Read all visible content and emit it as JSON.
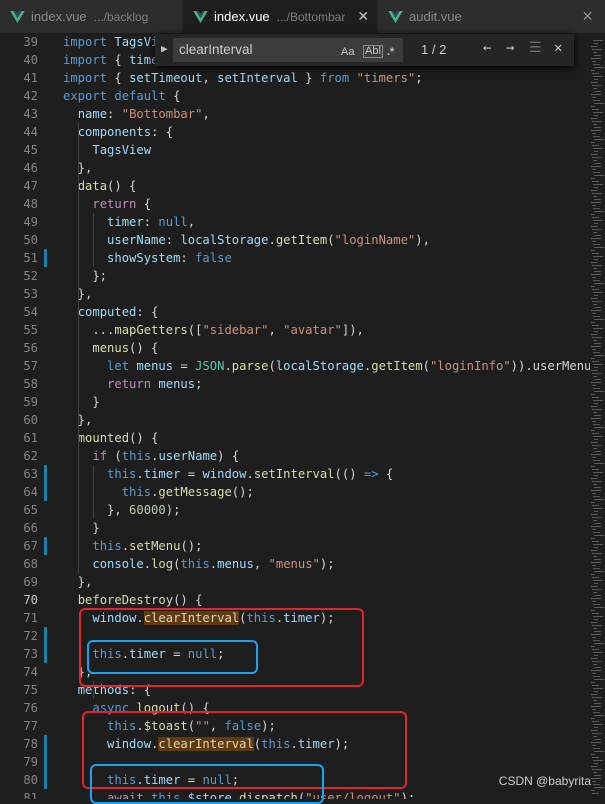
{
  "tabs": [
    {
      "name": "index.vue",
      "path": ".../backlog",
      "active": false
    },
    {
      "name": "index.vue",
      "path": ".../Bottombar",
      "active": true
    },
    {
      "name": "audit.vue",
      "path": "",
      "active": false
    }
  ],
  "find_widget": {
    "query": "clearInterval",
    "match_case": "Aa",
    "whole_word": "Abl",
    "regex": ".*",
    "result_count": "1 / 2"
  },
  "current_line": 70,
  "code_lines": [
    {
      "n": 39,
      "tokens": [
        [
          "kw",
          "import "
        ],
        [
          "var",
          "TagsVi"
        ]
      ]
    },
    {
      "n": 40,
      "tokens": [
        [
          "kw",
          "import "
        ],
        [
          "plain",
          "{ "
        ],
        [
          "var",
          "time"
        ]
      ]
    },
    {
      "n": 41,
      "tokens": [
        [
          "kw",
          "import "
        ],
        [
          "plain",
          "{ "
        ],
        [
          "var",
          "setTimeout"
        ],
        [
          "plain",
          ", "
        ],
        [
          "var",
          "setInterval"
        ],
        [
          "plain",
          " } "
        ],
        [
          "kw",
          "from "
        ],
        [
          "str",
          "\"timers\""
        ],
        [
          "plain",
          ";"
        ]
      ]
    },
    {
      "n": 42,
      "tokens": [
        [
          "kw",
          "export default "
        ],
        [
          "plain",
          "{"
        ]
      ]
    },
    {
      "n": 43,
      "tokens": [
        [
          "plain",
          "  "
        ],
        [
          "var",
          "name"
        ],
        [
          "plain",
          ": "
        ],
        [
          "str",
          "\"Bottombar\""
        ],
        [
          "plain",
          ","
        ]
      ]
    },
    {
      "n": 44,
      "tokens": [
        [
          "plain",
          "  "
        ],
        [
          "var",
          "components"
        ],
        [
          "plain",
          ": {"
        ]
      ]
    },
    {
      "n": 45,
      "tokens": [
        [
          "plain",
          "    "
        ],
        [
          "var",
          "TagsView"
        ]
      ]
    },
    {
      "n": 46,
      "tokens": [
        [
          "plain",
          "  },"
        ]
      ]
    },
    {
      "n": 47,
      "tokens": [
        [
          "plain",
          "  "
        ],
        [
          "fn",
          "data"
        ],
        [
          "plain",
          "() {"
        ]
      ]
    },
    {
      "n": 48,
      "tokens": [
        [
          "plain",
          "    "
        ],
        [
          "ctl",
          "return"
        ],
        [
          "plain",
          " {"
        ]
      ]
    },
    {
      "n": 49,
      "tokens": [
        [
          "plain",
          "      "
        ],
        [
          "var",
          "timer"
        ],
        [
          "plain",
          ": "
        ],
        [
          "kw",
          "null"
        ],
        [
          "plain",
          ","
        ]
      ]
    },
    {
      "n": 50,
      "tokens": [
        [
          "plain",
          "      "
        ],
        [
          "var",
          "userName"
        ],
        [
          "plain",
          ": "
        ],
        [
          "var",
          "localStorage"
        ],
        [
          "plain",
          "."
        ],
        [
          "fn",
          "getItem"
        ],
        [
          "plain",
          "("
        ],
        [
          "str",
          "\"loginName\""
        ],
        [
          "plain",
          "),"
        ]
      ]
    },
    {
      "n": 51,
      "tokens": [
        [
          "plain",
          "      "
        ],
        [
          "var",
          "showSystem"
        ],
        [
          "plain",
          ": "
        ],
        [
          "kw",
          "false"
        ]
      ],
      "mod": true
    },
    {
      "n": 52,
      "tokens": [
        [
          "plain",
          "    };"
        ]
      ]
    },
    {
      "n": 53,
      "tokens": [
        [
          "plain",
          "  },"
        ]
      ]
    },
    {
      "n": 54,
      "tokens": [
        [
          "plain",
          "  "
        ],
        [
          "var",
          "computed"
        ],
        [
          "plain",
          ": {"
        ]
      ]
    },
    {
      "n": 55,
      "tokens": [
        [
          "plain",
          "    ..."
        ],
        [
          "fn",
          "mapGetters"
        ],
        [
          "plain",
          "(["
        ],
        [
          "str",
          "\"sidebar\""
        ],
        [
          "plain",
          ", "
        ],
        [
          "str",
          "\"avatar\""
        ],
        [
          "plain",
          "]),"
        ]
      ]
    },
    {
      "n": 56,
      "tokens": [
        [
          "plain",
          "    "
        ],
        [
          "fn",
          "menus"
        ],
        [
          "plain",
          "() {"
        ]
      ]
    },
    {
      "n": 57,
      "tokens": [
        [
          "plain",
          "      "
        ],
        [
          "kw",
          "let "
        ],
        [
          "var",
          "menus"
        ],
        [
          "plain",
          " = "
        ],
        [
          "cls",
          "JSON"
        ],
        [
          "plain",
          "."
        ],
        [
          "fn",
          "parse"
        ],
        [
          "plain",
          "("
        ],
        [
          "var",
          "localStorage"
        ],
        [
          "plain",
          "."
        ],
        [
          "fn",
          "getItem"
        ],
        [
          "plain",
          "("
        ],
        [
          "str",
          "\"loginInfo\""
        ],
        [
          "plain",
          ")).userMenu"
        ]
      ]
    },
    {
      "n": 58,
      "tokens": [
        [
          "plain",
          "      "
        ],
        [
          "ctl",
          "return "
        ],
        [
          "var",
          "menus"
        ],
        [
          "plain",
          ";"
        ]
      ]
    },
    {
      "n": 59,
      "tokens": [
        [
          "plain",
          "    }"
        ]
      ]
    },
    {
      "n": 60,
      "tokens": [
        [
          "plain",
          "  },"
        ]
      ]
    },
    {
      "n": 61,
      "tokens": [
        [
          "plain",
          "  "
        ],
        [
          "fn",
          "mounted"
        ],
        [
          "plain",
          "() {"
        ]
      ]
    },
    {
      "n": 62,
      "tokens": [
        [
          "plain",
          "    "
        ],
        [
          "ctl",
          "if"
        ],
        [
          "plain",
          " ("
        ],
        [
          "kw",
          "this"
        ],
        [
          "plain",
          "."
        ],
        [
          "var",
          "userName"
        ],
        [
          "plain",
          ") {"
        ]
      ]
    },
    {
      "n": 63,
      "tokens": [
        [
          "plain",
          "      "
        ],
        [
          "kw",
          "this"
        ],
        [
          "plain",
          "."
        ],
        [
          "var",
          "timer"
        ],
        [
          "plain",
          " = "
        ],
        [
          "var",
          "window"
        ],
        [
          "plain",
          "."
        ],
        [
          "fn",
          "setInterval"
        ],
        [
          "plain",
          "(() "
        ],
        [
          "kw",
          "=>"
        ],
        [
          "plain",
          " {"
        ]
      ],
      "mod": true
    },
    {
      "n": 64,
      "tokens": [
        [
          "plain",
          "        "
        ],
        [
          "kw",
          "this"
        ],
        [
          "plain",
          "."
        ],
        [
          "fn",
          "getMessage"
        ],
        [
          "plain",
          "();"
        ]
      ],
      "mod": true
    },
    {
      "n": 65,
      "tokens": [
        [
          "plain",
          "      }, "
        ],
        [
          "num",
          "60000"
        ],
        [
          "plain",
          ");"
        ]
      ]
    },
    {
      "n": 66,
      "tokens": [
        [
          "plain",
          "    }"
        ]
      ]
    },
    {
      "n": 67,
      "tokens": [
        [
          "plain",
          "    "
        ],
        [
          "kw",
          "this"
        ],
        [
          "plain",
          "."
        ],
        [
          "fn",
          "setMenu"
        ],
        [
          "plain",
          "();"
        ]
      ],
      "mod": true
    },
    {
      "n": 68,
      "tokens": [
        [
          "plain",
          "    "
        ],
        [
          "var",
          "console"
        ],
        [
          "plain",
          "."
        ],
        [
          "fn",
          "log"
        ],
        [
          "plain",
          "("
        ],
        [
          "kw",
          "this"
        ],
        [
          "plain",
          "."
        ],
        [
          "var",
          "menus"
        ],
        [
          "plain",
          ", "
        ],
        [
          "str",
          "\"menus\""
        ],
        [
          "plain",
          ");"
        ]
      ]
    },
    {
      "n": 69,
      "tokens": [
        [
          "plain",
          "  },"
        ]
      ]
    },
    {
      "n": 70,
      "tokens": [
        [
          "plain",
          "  "
        ],
        [
          "fn",
          "beforeDestroy"
        ],
        [
          "plain",
          "() {"
        ]
      ]
    },
    {
      "n": 71,
      "tokens": [
        [
          "plain",
          "    "
        ],
        [
          "var",
          "window"
        ],
        [
          "plain",
          "."
        ],
        [
          "hl",
          "clearInterval"
        ],
        [
          "plain",
          "("
        ],
        [
          "kw",
          "this"
        ],
        [
          "plain",
          "."
        ],
        [
          "var",
          "timer"
        ],
        [
          "plain",
          ");"
        ]
      ]
    },
    {
      "n": 72,
      "tokens": [],
      "mod": true
    },
    {
      "n": 73,
      "tokens": [
        [
          "plain",
          "    "
        ],
        [
          "kw",
          "this"
        ],
        [
          "plain",
          "."
        ],
        [
          "var",
          "timer"
        ],
        [
          "plain",
          " = "
        ],
        [
          "kw",
          "null"
        ],
        [
          "plain",
          ";"
        ]
      ],
      "mod": true
    },
    {
      "n": 74,
      "tokens": [
        [
          "plain",
          "  },"
        ]
      ]
    },
    {
      "n": 75,
      "tokens": [
        [
          "plain",
          "  "
        ],
        [
          "var",
          "methods"
        ],
        [
          "plain",
          ": {"
        ]
      ]
    },
    {
      "n": 76,
      "tokens": [
        [
          "plain",
          "    "
        ],
        [
          "kw",
          "async "
        ],
        [
          "fn",
          "logout"
        ],
        [
          "plain",
          "() {"
        ]
      ]
    },
    {
      "n": 77,
      "tokens": [
        [
          "plain",
          "      "
        ],
        [
          "kw",
          "this"
        ],
        [
          "plain",
          "."
        ],
        [
          "fn",
          "$toast"
        ],
        [
          "plain",
          "("
        ],
        [
          "str",
          "\"\""
        ],
        [
          "plain",
          ", "
        ],
        [
          "kw",
          "false"
        ],
        [
          "plain",
          ");"
        ]
      ]
    },
    {
      "n": 78,
      "tokens": [
        [
          "plain",
          "      "
        ],
        [
          "var",
          "window"
        ],
        [
          "plain",
          "."
        ],
        [
          "hl",
          "clearInterval"
        ],
        [
          "plain",
          "("
        ],
        [
          "kw",
          "this"
        ],
        [
          "plain",
          "."
        ],
        [
          "var",
          "timer"
        ],
        [
          "plain",
          ");"
        ]
      ],
      "mod": true
    },
    {
      "n": 79,
      "tokens": [],
      "mod": true
    },
    {
      "n": 80,
      "tokens": [
        [
          "plain",
          "      "
        ],
        [
          "kw",
          "this"
        ],
        [
          "plain",
          "."
        ],
        [
          "var",
          "timer"
        ],
        [
          "plain",
          " = "
        ],
        [
          "kw",
          "null"
        ],
        [
          "plain",
          ";"
        ]
      ],
      "mod": true
    },
    {
      "n": 81,
      "tokens": [
        [
          "plain",
          "      "
        ],
        [
          "ctl",
          "await "
        ],
        [
          "kw",
          "this"
        ],
        [
          "plain",
          "."
        ],
        [
          "var",
          "$store"
        ],
        [
          "plain",
          "."
        ],
        [
          "fn",
          "dispatch"
        ],
        [
          "plain",
          "("
        ],
        [
          "str",
          "\"user/logout\""
        ],
        [
          "plain",
          ");"
        ]
      ]
    }
  ],
  "watermark": "CSDN @babyrita",
  "colors": {
    "annotation_red": "#e0262a",
    "annotation_blue": "#1ea0f0",
    "vue_green": "#41b883",
    "find_highlight": "#613a12"
  }
}
